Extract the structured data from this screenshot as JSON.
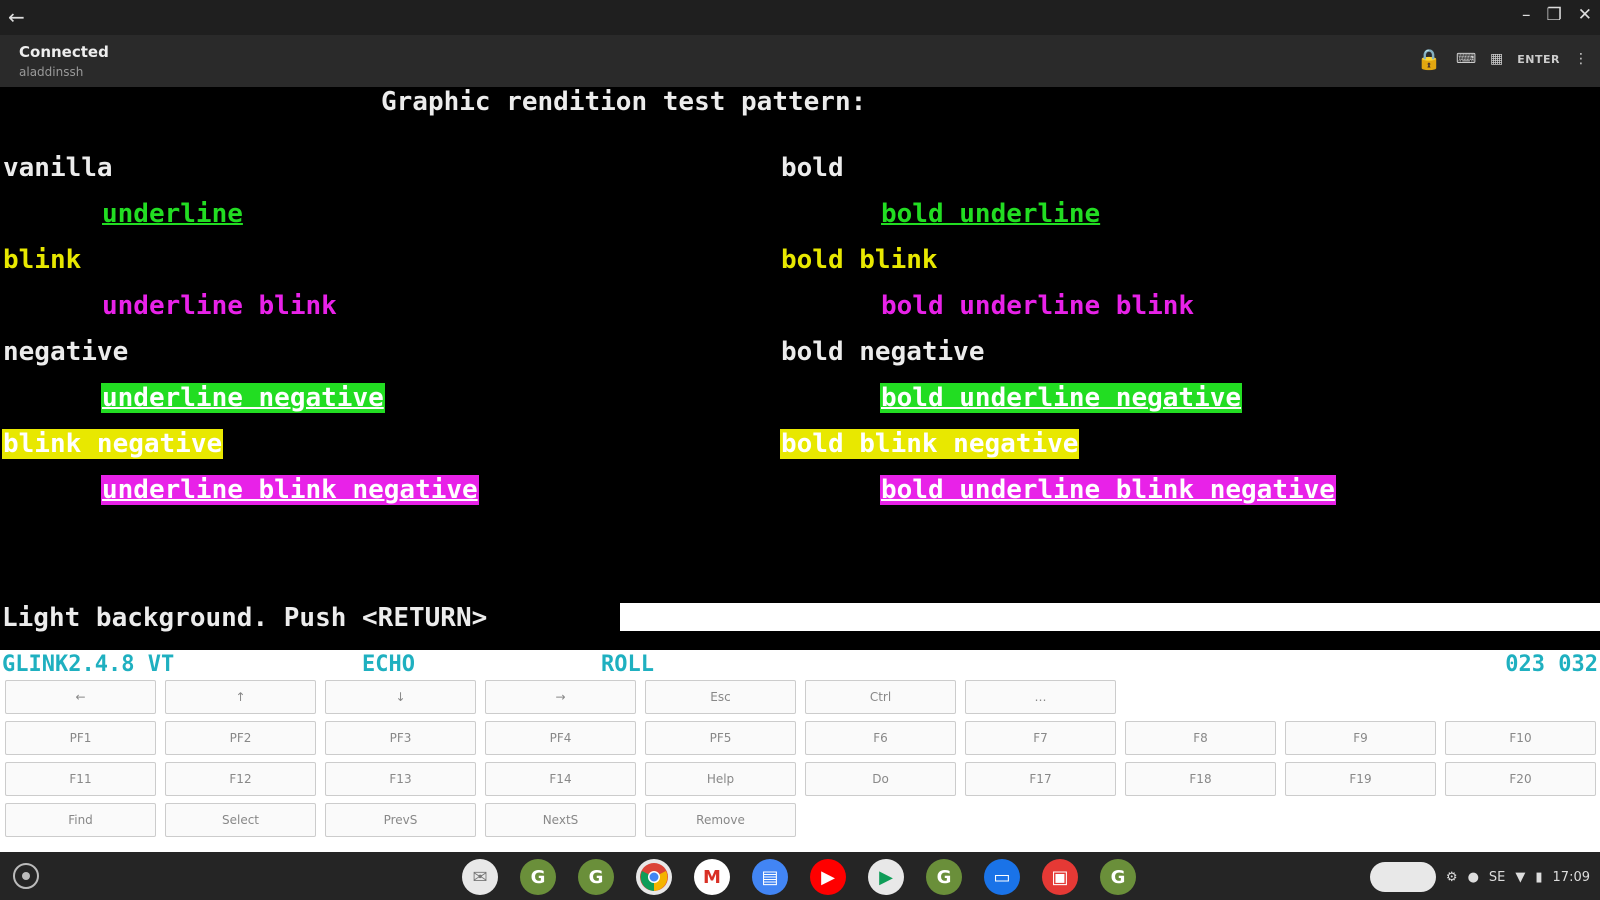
{
  "window": {
    "back_icon": "arrow-left-icon",
    "controls": [
      "minimize-icon",
      "restore-icon",
      "close-icon"
    ]
  },
  "appbar": {
    "status": "Connected",
    "host": "aladdinssh",
    "enter_label": "ENTER"
  },
  "terminal": {
    "title": "Graphic rendition test pattern:",
    "left": [
      "vanilla",
      "underline",
      "blink",
      "underline blink",
      "negative",
      "underline negative",
      "blink negative",
      "underline blink negative"
    ],
    "right": [
      "bold",
      "bold underline",
      "bold blink",
      "bold underline blink",
      "bold negative",
      "bold underline negative",
      "bold blink negative",
      "bold underline blink negative"
    ],
    "prompt": "Light background. Push <RETURN>"
  },
  "status_line": {
    "version": "GLINK2.4.8 VT",
    "echo": "ECHO",
    "roll": "ROLL",
    "position": "023 032"
  },
  "keypad": {
    "row1": [
      "←",
      "↑",
      "↓",
      "→",
      "Esc",
      "Ctrl",
      "…"
    ],
    "row2": [
      "PF1",
      "PF2",
      "PF3",
      "PF4",
      "PF5",
      "F6",
      "F7",
      "F8",
      "F9",
      "F10"
    ],
    "row3": [
      "F11",
      "F12",
      "F13",
      "F14",
      "Help",
      "Do",
      "F17",
      "F18",
      "F19",
      "F20"
    ],
    "row4": [
      "Find",
      "Select",
      "PrevS",
      "NextS",
      "Remove"
    ]
  },
  "shelf": {
    "apps": [
      "messages-icon",
      "glink-icon",
      "glink-icon-2",
      "chrome-icon",
      "gmail-icon",
      "docs-icon",
      "youtube-icon",
      "play-store-icon",
      "glink-icon-3",
      "files-icon",
      "screencast-icon",
      "glink-icon-4"
    ],
    "tray": {
      "locale": "SE",
      "time": "17:09"
    }
  }
}
